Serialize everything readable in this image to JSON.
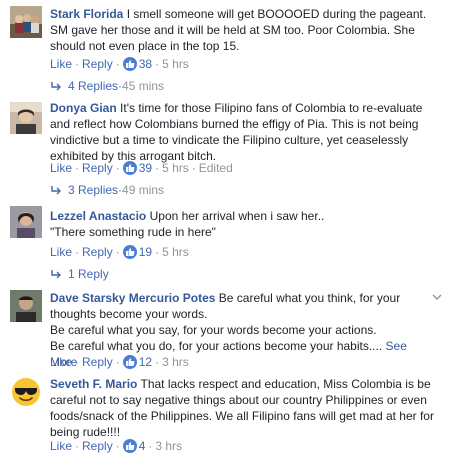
{
  "colors": {
    "link": "#365899",
    "action": "#4267b2",
    "meta": "#90949c",
    "like_badge": "#4a7ed6"
  },
  "comments": [
    {
      "author": "Stark Florida",
      "text": "I smell someone will get BOOOOED during the pageant. SM gave her those and it will be held at SM too. Poor Colombia. She should not even place in the top 15.",
      "like_label": "Like",
      "reply_label": "Reply",
      "reactions": "38",
      "time": "5 hrs",
      "replies": "4 Replies",
      "replies_time": "45 mins",
      "avatar_icon": "group-photo-avatar-icon"
    },
    {
      "author": "Donya Gian",
      "text": "It's time for those Filipino fans of Colombia to re-evaluate and reflect how Colombians burned the effigy of Pia. This is not being vindictive but a time to vindicate the Filipino culture, yet ceaselessly exhibited by this arrogant bitch.",
      "like_label": "Like",
      "reply_label": "Reply",
      "reactions": "39",
      "time": "5 hrs",
      "edited": "Edited",
      "replies": "3 Replies",
      "replies_time": "49 mins",
      "avatar_icon": "person-photo-avatar-icon"
    },
    {
      "author": "Lezzel Anastacio",
      "text": "Upon her arrival when i saw her..",
      "text2": "\"There something rude in here\"",
      "like_label": "Like",
      "reply_label": "Reply",
      "reactions": "19",
      "time": "5 hrs",
      "replies": "1 Reply",
      "avatar_icon": "person-photo-avatar-icon"
    },
    {
      "author": "Dave Starsky Mercurio Potes",
      "text": "Be careful what you think, for your thoughts become your words.",
      "text2": "Be careful what you say, for your words become your actions.",
      "text3": "Be careful what you do, for your actions become your habits....",
      "see_more": "See More",
      "like_label": "Like",
      "reply_label": "Reply",
      "reactions": "12",
      "time": "3 hrs",
      "avatar_icon": "person-photo-avatar-icon"
    },
    {
      "author": "Seveth F. Mario",
      "text": "That lacks respect and education, Miss Colombia is be careful not to say negative things about our country Philippines or even foods/snack of the Philippines. We all Filipino fans will get mad at her for being rude!!!!",
      "like_label": "Like",
      "reply_label": "Reply",
      "reactions": "4",
      "time": "3 hrs",
      "avatar_icon": "sunglasses-emoji-avatar-icon"
    }
  ]
}
